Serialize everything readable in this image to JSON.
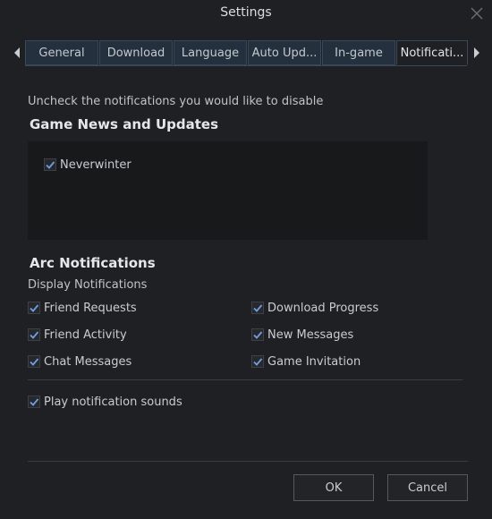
{
  "window": {
    "title": "Settings"
  },
  "tabs": [
    {
      "label": "General"
    },
    {
      "label": "Download"
    },
    {
      "label": "Language"
    },
    {
      "label": "Auto Upd..."
    },
    {
      "label": "In-game"
    },
    {
      "label": "Notificati..."
    }
  ],
  "active_tab": "Notificati...",
  "intro_text": "Uncheck the notifications you would like to disable",
  "game_section": {
    "title": "Game News and Updates",
    "items": [
      {
        "label": "Neverwinter",
        "checked": true
      }
    ]
  },
  "arc_section": {
    "title": "Arc Notifications",
    "subtitle": "Display Notifications",
    "items": [
      {
        "label": "Friend Requests",
        "checked": true
      },
      {
        "label": "Download Progress",
        "checked": true
      },
      {
        "label": "Friend Activity",
        "checked": true
      },
      {
        "label": "New Messages",
        "checked": true
      },
      {
        "label": "Chat Messages",
        "checked": true
      },
      {
        "label": "Game Invitation",
        "checked": true
      }
    ],
    "sound": {
      "label": "Play notification sounds",
      "checked": true
    }
  },
  "buttons": {
    "ok": "OK",
    "cancel": "Cancel"
  },
  "colors": {
    "accent_check": "#6f9ee0",
    "background": "#1f2023",
    "tab_bg": "#24303e"
  }
}
